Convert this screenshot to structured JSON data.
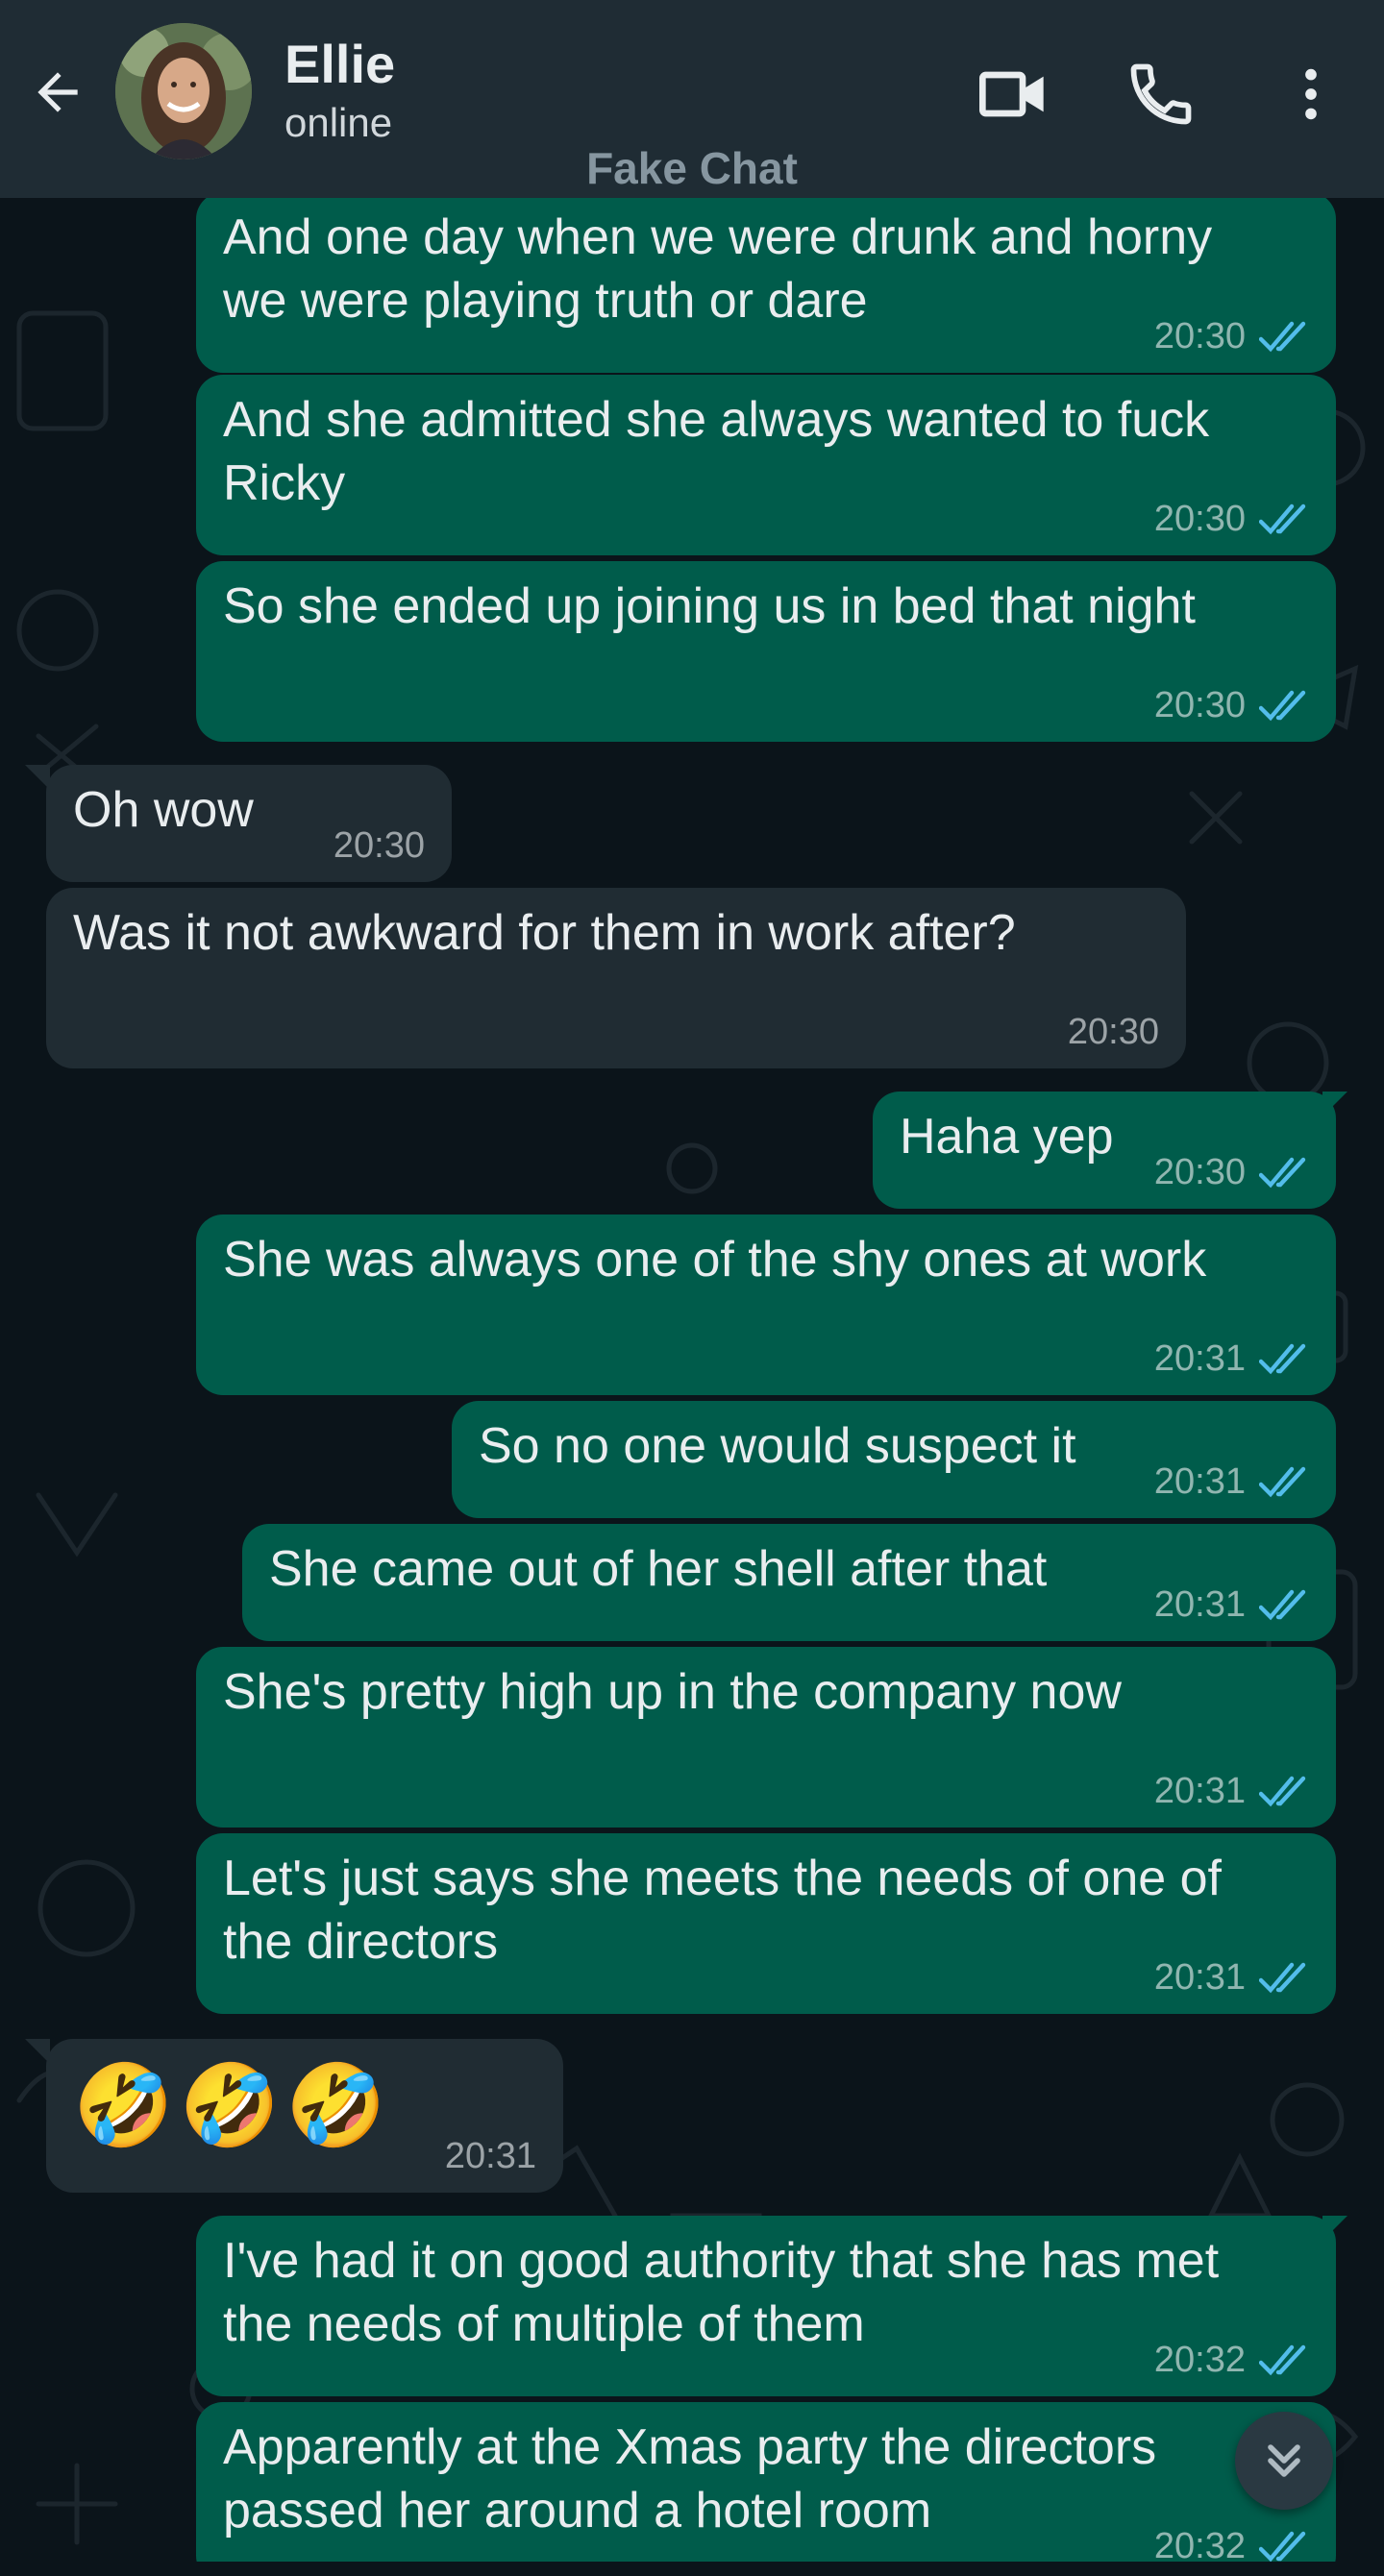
{
  "header": {
    "contact_name": "Ellie",
    "status": "online",
    "watermark": "Fake Chat",
    "icons": [
      "back-arrow-icon",
      "video-call-icon",
      "voice-call-icon",
      "more-options-icon"
    ]
  },
  "colors": {
    "header_bg": "#1f2c34",
    "chat_bg": "#0b141a",
    "outgoing_bubble": "#005c4b",
    "incoming_bubble": "#202c33",
    "read_ticks": "#53bdeb"
  },
  "messages": [
    {
      "direction": "out",
      "text": "And one day when we were drunk and horny\nwe were playing truth or dare",
      "time": "20:30",
      "read": true
    },
    {
      "direction": "out",
      "text": "And she admitted she always wanted to fuck\nRicky",
      "time": "20:30",
      "read": true
    },
    {
      "direction": "out",
      "text": "So she ended up joining us in bed that night",
      "time": "20:30",
      "read": true
    },
    {
      "direction": "in",
      "text": "Oh wow",
      "time": "20:30"
    },
    {
      "direction": "in",
      "text": "Was it not awkward for them in work after?",
      "time": "20:30"
    },
    {
      "direction": "out",
      "text": "Haha yep",
      "time": "20:30",
      "read": true
    },
    {
      "direction": "out",
      "text": "She was always one of the shy ones at work",
      "time": "20:31",
      "read": true
    },
    {
      "direction": "out",
      "text": "So no one would suspect it",
      "time": "20:31",
      "read": true
    },
    {
      "direction": "out",
      "text": "She came out of her shell after that",
      "time": "20:31",
      "read": true
    },
    {
      "direction": "out",
      "text": "She's pretty high up in the company now",
      "time": "20:31",
      "read": true
    },
    {
      "direction": "out",
      "text": "Let's just says she meets the needs of one of\nthe directors",
      "time": "20:31",
      "read": true
    },
    {
      "direction": "in",
      "text": "🤣🤣🤣",
      "time": "20:31",
      "emoji": true
    },
    {
      "direction": "out",
      "text": "I've had it on good authority that she has met\nthe needs of multiple of them",
      "time": "20:32",
      "read": true
    },
    {
      "direction": "out",
      "text": "Apparently at the Xmas party the directors\npassed her around a hotel room",
      "time": "20:32",
      "read": true
    }
  ],
  "scroll_button_icon": "chevron-double-down-icon"
}
